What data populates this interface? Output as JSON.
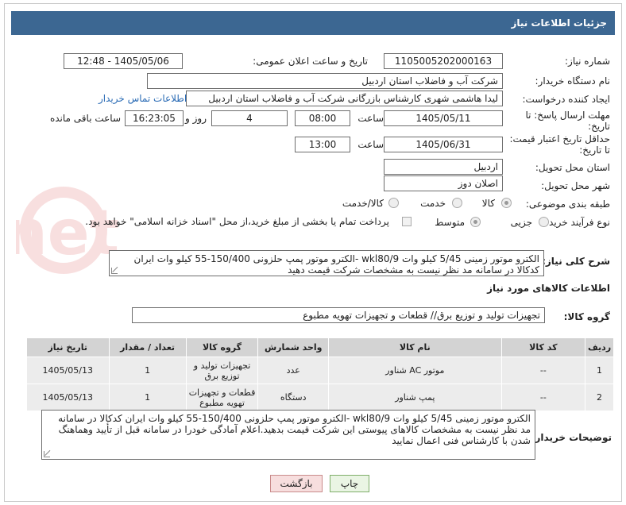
{
  "header": {
    "title": "جزئیات اطلاعات نیاز"
  },
  "fields": {
    "need_number_label": "شماره نیاز:",
    "need_number": "1105005202000163",
    "announce_label": "تاریخ و ساعت اعلان عمومی:",
    "announce_value": "1405/05/06 - 12:48",
    "buyer_org_label": "نام دستگاه خریدار:",
    "buyer_org": "شرکت آب و فاضلاب استان اردبیل",
    "creator_label": "ایجاد کننده درخواست:",
    "creator": "لیدا  هاشمی شهری کارشناس بازرگانی شرکت آب و فاضلاب استان اردبیل",
    "contact_link": "اطلاعات تماس خریدار",
    "deadline_label": "مهلت ارسال پاسخ: تا تاریخ:",
    "deadline_date": "1405/05/11",
    "hour_label": "ساعت",
    "deadline_time": "08:00",
    "days_value": "4",
    "days_label": "روز و",
    "remaining_time": "16:23:05",
    "remaining_label": "ساعت باقی مانده",
    "validity_label": "حداقل تاریخ اعتبار قیمت: تا تاریخ:",
    "validity_date": "1405/06/31",
    "validity_time": "13:00",
    "province_label": "استان محل تحویل:",
    "province": "اردبیل",
    "city_label": "شهر محل تحویل:",
    "city": "اصلان دوز",
    "category_label": "طبقه بندی موضوعی:",
    "cat_goods": "کالا",
    "cat_service": "خدمت",
    "cat_goods_service": "کالا/خدمت",
    "process_label": "نوع فرآیند خرید :",
    "proc_partial": "جزیی",
    "proc_medium": "متوسط",
    "payment_note": "پرداخت تمام یا بخشی از مبلغ خرید،از محل \"اسناد خزانه اسلامی\" خواهد بود."
  },
  "description": {
    "label": "شرح کلی نیاز:",
    "text": "الکترو موتور زمینی 5/45 کیلو وات wkl80/9 -الکترو موتور پمپ حلزونی 150/400-55  کیلو وات ایران کدکالا در سامانه مد نظر نیست به مشخصات شرکت قیمت دهید"
  },
  "goods_section": {
    "title": "اطلاعات کالاهای مورد نیاز",
    "group_label": "گروه کالا:",
    "group_value": "تجهیزات تولید و توزیع برق//  قطعات و تجهیزات تهویه مطبوع",
    "columns": [
      "ردیف",
      "کد کالا",
      "نام کالا",
      "واحد شمارش",
      "گروه کالا",
      "تعداد / مقدار",
      "تاریخ نیاز"
    ],
    "rows": [
      [
        "1",
        "--",
        "موتور AC شناور",
        "عدد",
        "تجهیزات تولید و توزیع برق",
        "1",
        "1405/05/13"
      ],
      [
        "2",
        "--",
        "پمپ شناور",
        "دستگاه",
        "قطعات و تجهیزات تهویه مطبوع",
        "1",
        "1405/05/13"
      ]
    ]
  },
  "buyer_notes": {
    "label": "توضیحات خریدار:",
    "text": "الکترو موتور زمینی 5/45 کیلو وات wkl80/9 -الکترو موتور پمپ حلزونی 150/400-55  کیلو وات  ایران کدکالا در سامانه مد نظر نیست به مشخصات کالاهای پیوستی این شرکت قیمت بدهید.اعلام آمادگی خودرا در سامانه  قبل از تأیید وهماهنگ شدن با کارشناس فنی اعمال نمایید"
  },
  "buttons": {
    "print": "چاپ",
    "back": "بازگشت"
  },
  "watermark_text": "AriaTender.net",
  "colors": {
    "header_bg": "#3c6792",
    "link": "#2a6bb5"
  }
}
